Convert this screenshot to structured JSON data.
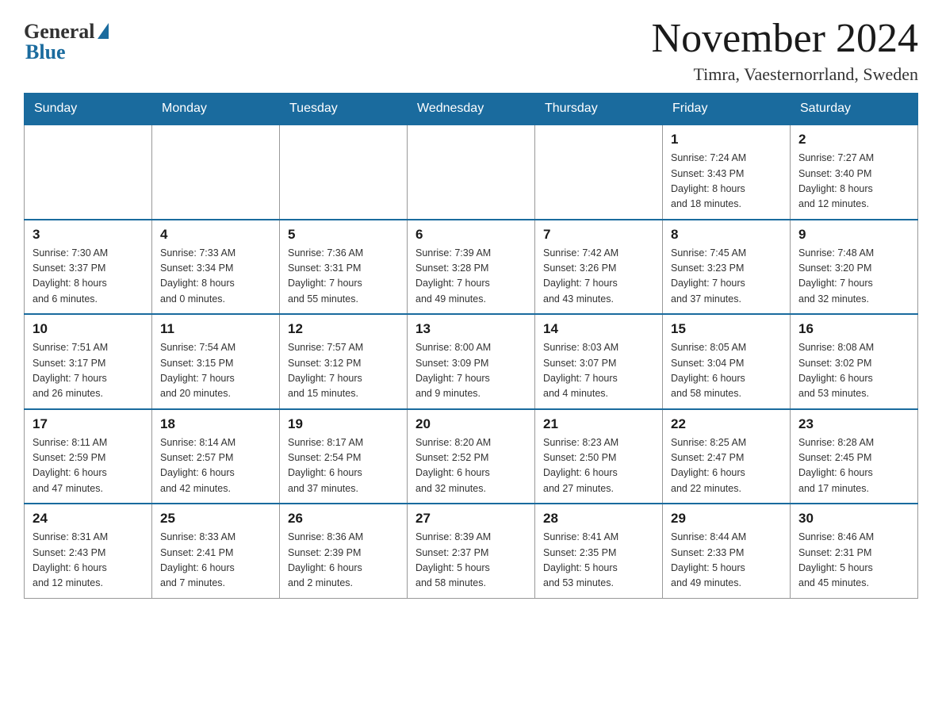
{
  "logo": {
    "general": "General",
    "blue": "Blue"
  },
  "title": "November 2024",
  "location": "Timra, Vaesternorrland, Sweden",
  "days_of_week": [
    "Sunday",
    "Monday",
    "Tuesday",
    "Wednesday",
    "Thursday",
    "Friday",
    "Saturday"
  ],
  "weeks": [
    [
      {
        "day": "",
        "info": ""
      },
      {
        "day": "",
        "info": ""
      },
      {
        "day": "",
        "info": ""
      },
      {
        "day": "",
        "info": ""
      },
      {
        "day": "",
        "info": ""
      },
      {
        "day": "1",
        "info": "Sunrise: 7:24 AM\nSunset: 3:43 PM\nDaylight: 8 hours\nand 18 minutes."
      },
      {
        "day": "2",
        "info": "Sunrise: 7:27 AM\nSunset: 3:40 PM\nDaylight: 8 hours\nand 12 minutes."
      }
    ],
    [
      {
        "day": "3",
        "info": "Sunrise: 7:30 AM\nSunset: 3:37 PM\nDaylight: 8 hours\nand 6 minutes."
      },
      {
        "day": "4",
        "info": "Sunrise: 7:33 AM\nSunset: 3:34 PM\nDaylight: 8 hours\nand 0 minutes."
      },
      {
        "day": "5",
        "info": "Sunrise: 7:36 AM\nSunset: 3:31 PM\nDaylight: 7 hours\nand 55 minutes."
      },
      {
        "day": "6",
        "info": "Sunrise: 7:39 AM\nSunset: 3:28 PM\nDaylight: 7 hours\nand 49 minutes."
      },
      {
        "day": "7",
        "info": "Sunrise: 7:42 AM\nSunset: 3:26 PM\nDaylight: 7 hours\nand 43 minutes."
      },
      {
        "day": "8",
        "info": "Sunrise: 7:45 AM\nSunset: 3:23 PM\nDaylight: 7 hours\nand 37 minutes."
      },
      {
        "day": "9",
        "info": "Sunrise: 7:48 AM\nSunset: 3:20 PM\nDaylight: 7 hours\nand 32 minutes."
      }
    ],
    [
      {
        "day": "10",
        "info": "Sunrise: 7:51 AM\nSunset: 3:17 PM\nDaylight: 7 hours\nand 26 minutes."
      },
      {
        "day": "11",
        "info": "Sunrise: 7:54 AM\nSunset: 3:15 PM\nDaylight: 7 hours\nand 20 minutes."
      },
      {
        "day": "12",
        "info": "Sunrise: 7:57 AM\nSunset: 3:12 PM\nDaylight: 7 hours\nand 15 minutes."
      },
      {
        "day": "13",
        "info": "Sunrise: 8:00 AM\nSunset: 3:09 PM\nDaylight: 7 hours\nand 9 minutes."
      },
      {
        "day": "14",
        "info": "Sunrise: 8:03 AM\nSunset: 3:07 PM\nDaylight: 7 hours\nand 4 minutes."
      },
      {
        "day": "15",
        "info": "Sunrise: 8:05 AM\nSunset: 3:04 PM\nDaylight: 6 hours\nand 58 minutes."
      },
      {
        "day": "16",
        "info": "Sunrise: 8:08 AM\nSunset: 3:02 PM\nDaylight: 6 hours\nand 53 minutes."
      }
    ],
    [
      {
        "day": "17",
        "info": "Sunrise: 8:11 AM\nSunset: 2:59 PM\nDaylight: 6 hours\nand 47 minutes."
      },
      {
        "day": "18",
        "info": "Sunrise: 8:14 AM\nSunset: 2:57 PM\nDaylight: 6 hours\nand 42 minutes."
      },
      {
        "day": "19",
        "info": "Sunrise: 8:17 AM\nSunset: 2:54 PM\nDaylight: 6 hours\nand 37 minutes."
      },
      {
        "day": "20",
        "info": "Sunrise: 8:20 AM\nSunset: 2:52 PM\nDaylight: 6 hours\nand 32 minutes."
      },
      {
        "day": "21",
        "info": "Sunrise: 8:23 AM\nSunset: 2:50 PM\nDaylight: 6 hours\nand 27 minutes."
      },
      {
        "day": "22",
        "info": "Sunrise: 8:25 AM\nSunset: 2:47 PM\nDaylight: 6 hours\nand 22 minutes."
      },
      {
        "day": "23",
        "info": "Sunrise: 8:28 AM\nSunset: 2:45 PM\nDaylight: 6 hours\nand 17 minutes."
      }
    ],
    [
      {
        "day": "24",
        "info": "Sunrise: 8:31 AM\nSunset: 2:43 PM\nDaylight: 6 hours\nand 12 minutes."
      },
      {
        "day": "25",
        "info": "Sunrise: 8:33 AM\nSunset: 2:41 PM\nDaylight: 6 hours\nand 7 minutes."
      },
      {
        "day": "26",
        "info": "Sunrise: 8:36 AM\nSunset: 2:39 PM\nDaylight: 6 hours\nand 2 minutes."
      },
      {
        "day": "27",
        "info": "Sunrise: 8:39 AM\nSunset: 2:37 PM\nDaylight: 5 hours\nand 58 minutes."
      },
      {
        "day": "28",
        "info": "Sunrise: 8:41 AM\nSunset: 2:35 PM\nDaylight: 5 hours\nand 53 minutes."
      },
      {
        "day": "29",
        "info": "Sunrise: 8:44 AM\nSunset: 2:33 PM\nDaylight: 5 hours\nand 49 minutes."
      },
      {
        "day": "30",
        "info": "Sunrise: 8:46 AM\nSunset: 2:31 PM\nDaylight: 5 hours\nand 45 minutes."
      }
    ]
  ]
}
